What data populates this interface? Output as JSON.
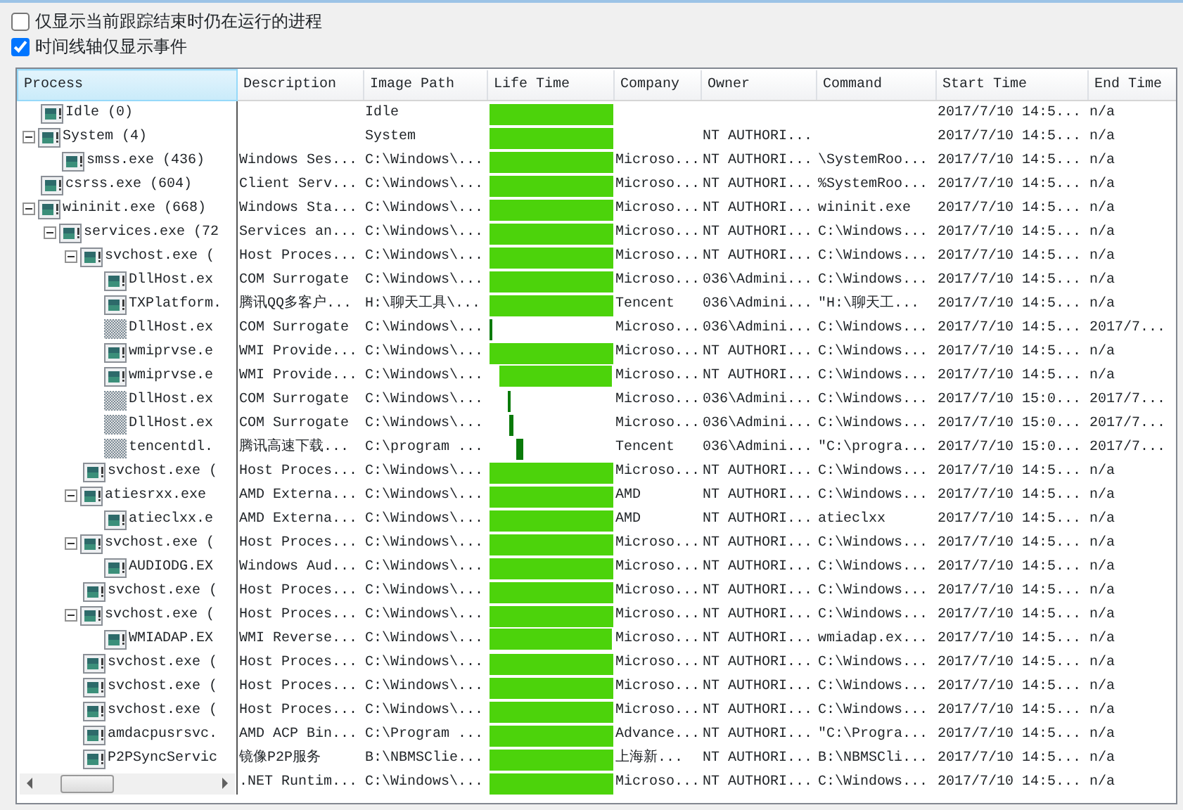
{
  "options": [
    {
      "label": "仅显示当前跟踪结束时仍在运行的进程",
      "checked": false
    },
    {
      "label": "时间线轴仅显示事件",
      "checked": true
    }
  ],
  "columns": [
    {
      "label": "Process",
      "selected": true
    },
    {
      "label": "Description",
      "selected": false
    },
    {
      "label": "Image Path",
      "selected": false
    },
    {
      "label": "Life Time",
      "selected": false
    },
    {
      "label": "Company",
      "selected": false
    },
    {
      "label": "Owner",
      "selected": false
    },
    {
      "label": "Command",
      "selected": false
    },
    {
      "label": "Start Time",
      "selected": false
    },
    {
      "label": "End Time",
      "selected": false
    }
  ],
  "processes": [
    {
      "process": "Idle (0)",
      "exited": false,
      "image_path": "Idle",
      "life": [
        {
          "kind": "bar",
          "level": 1
        }
      ],
      "start_time": "2017/7/10 14:5...",
      "end_time": "n/a"
    },
    {
      "process": "System (4)",
      "exited": false,
      "expanded": true,
      "image_path": "System",
      "life": [
        {
          "kind": "bar",
          "level": 1
        }
      ],
      "owner": "NT AUTHORI...",
      "start_time": "2017/7/10 14:5...",
      "end_time": "n/a",
      "children": [
        {
          "process": "smss.exe (436)",
          "exited": false,
          "description": "Windows Ses...",
          "image_path": "C:\\Windows\\...",
          "life": [
            {
              "kind": "bar",
              "level": 1
            }
          ],
          "company": "Microso...",
          "owner": "NT AUTHORI...",
          "command": "\\SystemRoo...",
          "start_time": "2017/7/10 14:5...",
          "end_time": "n/a"
        }
      ]
    },
    {
      "process": "csrss.exe (604)",
      "exited": false,
      "description": "Client Serv...",
      "image_path": "C:\\Windows\\...",
      "life": [
        {
          "kind": "bar",
          "level": 1
        }
      ],
      "company": "Microso...",
      "owner": "NT AUTHORI...",
      "command": "%SystemRoo...",
      "start_time": "2017/7/10 14:5...",
      "end_time": "n/a"
    },
    {
      "process": "wininit.exe (668)",
      "exited": false,
      "expanded": true,
      "description": "Windows Sta...",
      "image_path": "C:\\Windows\\...",
      "life": [
        {
          "kind": "bar",
          "level": 1
        }
      ],
      "company": "Microso...",
      "owner": "NT AUTHORI...",
      "command": "wininit.exe",
      "start_time": "2017/7/10 14:5...",
      "end_time": "n/a",
      "children": [
        {
          "process": "services.exe (72",
          "exited": false,
          "expanded": true,
          "description": "Services an...",
          "image_path": "C:\\Windows\\...",
          "life": [
            {
              "kind": "bar",
              "level": 1
            }
          ],
          "company": "Microso...",
          "owner": "NT AUTHORI...",
          "command": "C:\\Windows...",
          "start_time": "2017/7/10 14:5...",
          "end_time": "n/a",
          "children": [
            {
              "process": "svchost.exe (",
              "exited": false,
              "expanded": true,
              "description": "Host Proces...",
              "image_path": "C:\\Windows\\...",
              "life": [
                {
                  "kind": "bar",
                  "level": 1
                }
              ],
              "company": "Microso...",
              "owner": "NT AUTHORI...",
              "command": "C:\\Windows...",
              "start_time": "2017/7/10 14:5...",
              "end_time": "n/a",
              "children": [
                {
                  "process": "DllHost.ex",
                  "exited": false,
                  "description": "COM Surrogate",
                  "image_path": "C:\\Windows\\...",
                  "life": [
                    {
                      "kind": "bar",
                      "level": 1
                    }
                  ],
                  "company": "Microso...",
                  "owner": "036\\Admini...",
                  "command": "C:\\Windows...",
                  "start_time": "2017/7/10 14:5...",
                  "end_time": "n/a"
                },
                {
                  "process": "TXPlatform.",
                  "exited": false,
                  "description": "腾讯QQ多客户...",
                  "image_path": "H:\\聊天工具\\...",
                  "life": [
                    {
                      "kind": "bar",
                      "level": 1
                    }
                  ],
                  "company": "Tencent",
                  "owner": "036\\Admini...",
                  "command": "″H:\\聊天工...",
                  "start_time": "2017/7/10 14:5...",
                  "end_time": "n/a"
                },
                {
                  "process": "DllHost.ex",
                  "exited": true,
                  "description": "COM Surrogate",
                  "image_path": "C:\\Windows\\...",
                  "life": [
                    {
                      "kind": "tick",
                      "level": 0.0125
                    }
                  ],
                  "company": "Microso...",
                  "owner": "036\\Admini...",
                  "command": "C:\\Windows...",
                  "start_time": "2017/7/10 14:5...",
                  "end_time": "2017/7..."
                },
                {
                  "process": "wmiprvse.e",
                  "exited": false,
                  "description": "WMI Provide...",
                  "image_path": "C:\\Windows\\...",
                  "life": [
                    {
                      "kind": "bar",
                      "level": 1
                    }
                  ],
                  "company": "Microso...",
                  "owner": "NT AUTHORI...",
                  "command": "C:\\Windows...",
                  "start_time": "2017/7/10 14:5...",
                  "end_time": "n/a"
                },
                {
                  "process": "wmiprvse.e",
                  "exited": false,
                  "description": "WMI Provide...",
                  "image_path": "C:\\Windows\\...",
                  "life": [
                    {
                      "kind": "gap",
                      "level": 0.08
                    },
                    {
                      "kind": "bar",
                      "level": 0.92
                    }
                  ],
                  "company": "Microso...",
                  "owner": "NT AUTHORI...",
                  "command": "C:\\Windows...",
                  "start_time": "2017/7/10 14:5...",
                  "end_time": "n/a"
                },
                {
                  "process": "DllHost.ex",
                  "exited": true,
                  "description": "COM Surrogate",
                  "image_path": "C:\\Windows\\...",
                  "life": [
                    {
                      "kind": "tick",
                      "level": 0.1625
                    }
                  ],
                  "company": "Microso...",
                  "owner": "036\\Admini...",
                  "command": "C:\\Windows...",
                  "start_time": "2017/7/10 15:0...",
                  "end_time": "2017/7..."
                },
                {
                  "process": "DllHost.ex",
                  "exited": true,
                  "description": "COM Surrogate",
                  "image_path": "C:\\Windows\\...",
                  "life": [
                    {
                      "kind": "tick",
                      "level": 0.1825
                    }
                  ],
                  "company": "Microso...",
                  "owner": "036\\Admini...",
                  "command": "C:\\Windows...",
                  "start_time": "2017/7/10 15:0...",
                  "end_time": "2017/7..."
                },
                {
                  "process": "tencentdl.",
                  "exited": true,
                  "description": "腾讯高速下载...",
                  "image_path": "C:\\program ...",
                  "life": [
                    {
                      "kind": "block",
                      "level": 0.25
                    }
                  ],
                  "company": "Tencent",
                  "owner": "036\\Admini...",
                  "command": "″C:\\progra...",
                  "start_time": "2017/7/10 15:0...",
                  "end_time": "2017/7..."
                }
              ]
            },
            {
              "process": "svchost.exe (",
              "exited": false,
              "description": "Host Proces...",
              "image_path": "C:\\Windows\\...",
              "life": [
                {
                  "kind": "bar",
                  "level": 1
                }
              ],
              "company": "Microso...",
              "owner": "NT AUTHORI...",
              "command": "C:\\Windows...",
              "start_time": "2017/7/10 14:5...",
              "end_time": "n/a"
            },
            {
              "process": "atiesrxx.exe",
              "exited": false,
              "expanded": true,
              "description": "AMD Externa...",
              "image_path": "C:\\Windows\\...",
              "life": [
                {
                  "kind": "bar",
                  "level": 1
                }
              ],
              "company": "AMD",
              "owner": "NT AUTHORI...",
              "command": "C:\\Windows...",
              "start_time": "2017/7/10 14:5...",
              "end_time": "n/a",
              "children": [
                {
                  "process": "atieclxx.e",
                  "exited": false,
                  "description": "AMD Externa...",
                  "image_path": "C:\\Windows\\...",
                  "life": [
                    {
                      "kind": "bar",
                      "level": 1
                    }
                  ],
                  "company": "AMD",
                  "owner": "NT AUTHORI...",
                  "command": "atieclxx",
                  "start_time": "2017/7/10 14:5...",
                  "end_time": "n/a"
                }
              ]
            },
            {
              "process": "svchost.exe (",
              "exited": false,
              "expanded": true,
              "description": "Host Proces...",
              "image_path": "C:\\Windows\\...",
              "life": [
                {
                  "kind": "bar",
                  "level": 1
                }
              ],
              "company": "Microso...",
              "owner": "NT AUTHORI...",
              "command": "C:\\Windows...",
              "start_time": "2017/7/10 14:5...",
              "end_time": "n/a",
              "children": [
                {
                  "process": "AUDIODG.EX",
                  "exited": false,
                  "description": "Windows Aud...",
                  "image_path": "C:\\Windows\\...",
                  "life": [
                    {
                      "kind": "bar",
                      "level": 1
                    }
                  ],
                  "company": "Microso...",
                  "owner": "NT AUTHORI...",
                  "command": "C:\\Windows...",
                  "start_time": "2017/7/10 14:5...",
                  "end_time": "n/a"
                }
              ]
            },
            {
              "process": "svchost.exe (",
              "exited": false,
              "description": "Host Proces...",
              "image_path": "C:\\Windows\\...",
              "life": [
                {
                  "kind": "bar",
                  "level": 1
                }
              ],
              "company": "Microso...",
              "owner": "NT AUTHORI...",
              "command": "C:\\Windows...",
              "start_time": "2017/7/10 14:5...",
              "end_time": "n/a"
            },
            {
              "process": "svchost.exe (",
              "exited": false,
              "expanded": true,
              "description": "Host Proces...",
              "image_path": "C:\\Windows\\...",
              "life": [
                {
                  "kind": "bar",
                  "level": 1
                }
              ],
              "company": "Microso...",
              "owner": "NT AUTHORI...",
              "command": "C:\\Windows...",
              "start_time": "2017/7/10 14:5...",
              "end_time": "n/a",
              "children": [
                {
                  "process": "WMIADAP.EX",
                  "exited": false,
                  "description": "WMI Reverse...",
                  "image_path": "C:\\Windows\\...",
                  "life": [
                    {
                      "kind": "gap",
                      "level": 0.01
                    },
                    {
                      "kind": "bar",
                      "level": 0.99
                    }
                  ],
                  "company": "Microso...",
                  "owner": "NT AUTHORI...",
                  "command": "wmiadap.ex...",
                  "start_time": "2017/7/10 14:5...",
                  "end_time": "n/a"
                }
              ]
            },
            {
              "process": "svchost.exe (",
              "exited": false,
              "description": "Host Proces...",
              "image_path": "C:\\Windows\\...",
              "life": [
                {
                  "kind": "bar",
                  "level": 1
                }
              ],
              "company": "Microso...",
              "owner": "NT AUTHORI...",
              "command": "C:\\Windows...",
              "start_time": "2017/7/10 14:5...",
              "end_time": "n/a"
            },
            {
              "process": "svchost.exe (",
              "exited": false,
              "description": "Host Proces...",
              "image_path": "C:\\Windows\\...",
              "life": [
                {
                  "kind": "bar",
                  "level": 1
                }
              ],
              "company": "Microso...",
              "owner": "NT AUTHORI...",
              "command": "C:\\Windows...",
              "start_time": "2017/7/10 14:5...",
              "end_time": "n/a"
            },
            {
              "process": "svchost.exe (",
              "exited": false,
              "description": "Host Proces...",
              "image_path": "C:\\Windows\\...",
              "life": [
                {
                  "kind": "bar",
                  "level": 1
                }
              ],
              "company": "Microso...",
              "owner": "NT AUTHORI...",
              "command": "C:\\Windows...",
              "start_time": "2017/7/10 14:5...",
              "end_time": "n/a"
            },
            {
              "process": "amdacpusrsvc.",
              "exited": false,
              "description": "AMD ACP Bin...",
              "image_path": "C:\\Program ...",
              "life": [
                {
                  "kind": "bar",
                  "level": 1
                }
              ],
              "company": "Advance...",
              "owner": "NT AUTHORI...",
              "command": "″C:\\Progra...",
              "start_time": "2017/7/10 14:5...",
              "end_time": "n/a"
            },
            {
              "process": "P2PSyncServic",
              "exited": false,
              "description": "镜像P2P服务",
              "image_path": "B:\\NBMSClie...",
              "life": [
                {
                  "kind": "bar",
                  "level": 1
                }
              ],
              "company": "上海新...",
              "owner": "NT AUTHORI...",
              "command": "B:\\NBMSCli...",
              "start_time": "2017/7/10 14:5...",
              "end_time": "n/a"
            },
            {
              "description": ".NET Runtim...",
              "image_path": "C:\\Windows\\...",
              "life": [
                {
                  "kind": "bar",
                  "level": 1
                }
              ],
              "company": "Microso...",
              "owner": "NT AUTHORI...",
              "command": "C:\\Windows...",
              "start_time": "2017/7/10 14:5...",
              "end_time": "n/a"
            }
          ]
        }
      ]
    }
  ]
}
